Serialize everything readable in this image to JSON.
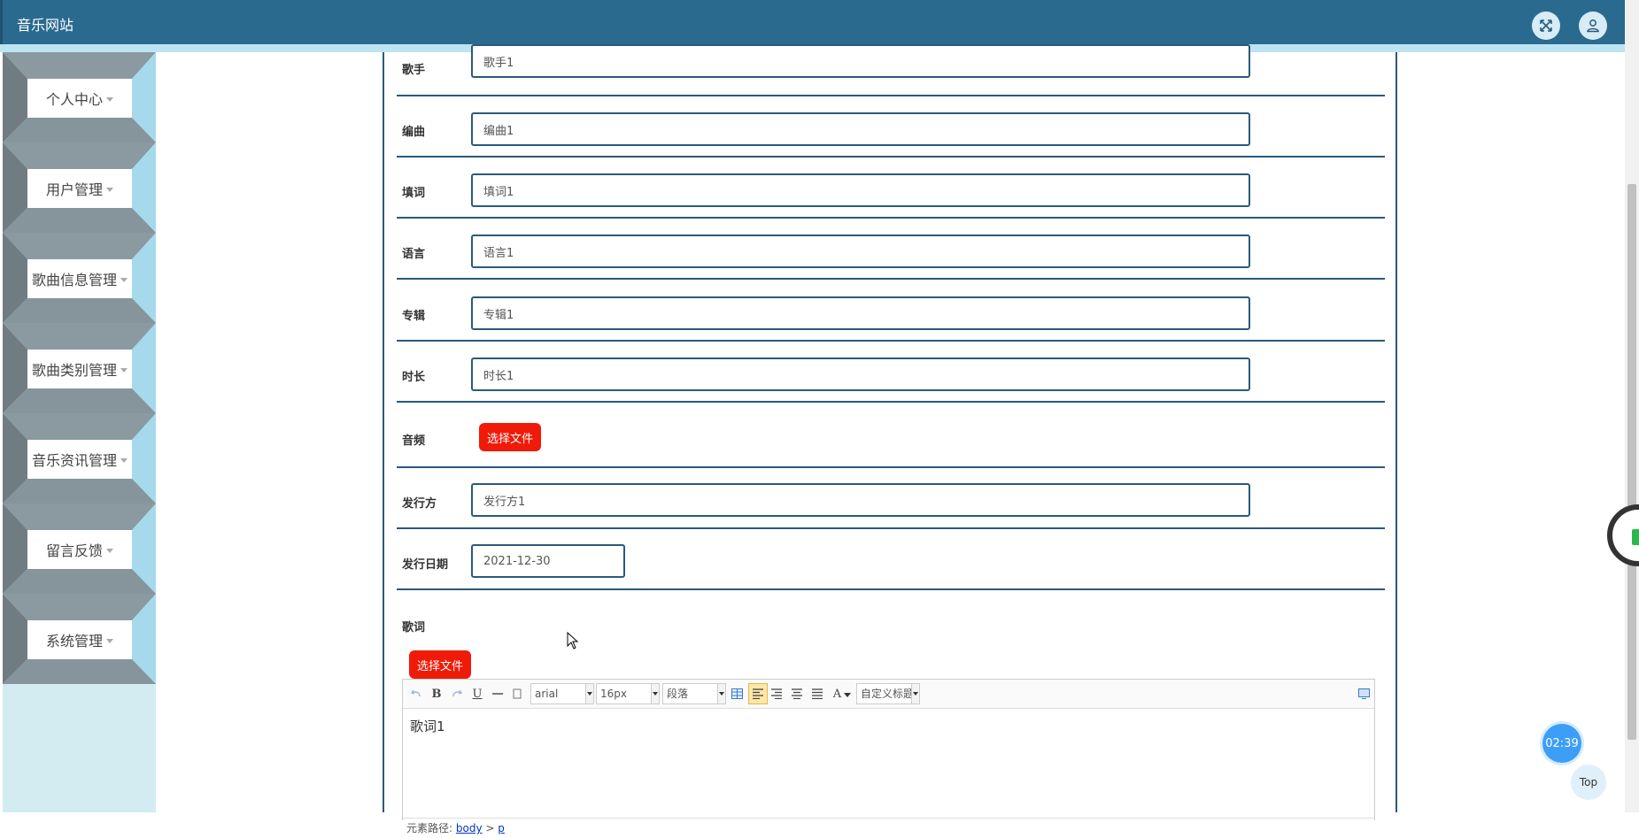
{
  "header": {
    "title": "音乐网站",
    "fullscreen_icon": "expand-arrows-icon",
    "user_icon": "user-icon"
  },
  "sidebar": {
    "items": [
      {
        "label": "个人中心"
      },
      {
        "label": "用户管理"
      },
      {
        "label": "歌曲信息管理"
      },
      {
        "label": "歌曲类别管理"
      },
      {
        "label": "音乐资讯管理"
      },
      {
        "label": "留言反馈"
      },
      {
        "label": "系统管理"
      }
    ]
  },
  "form": {
    "singer": {
      "label": "歌手",
      "value": "歌手1"
    },
    "composer": {
      "label": "编曲",
      "value": "编曲1"
    },
    "lyricist": {
      "label": "填词",
      "value": "填词1"
    },
    "language": {
      "label": "语言",
      "value": "语言1"
    },
    "album": {
      "label": "专辑",
      "value": "专辑1"
    },
    "duration": {
      "label": "时长",
      "value": "时长1"
    },
    "audio": {
      "label": "音频",
      "button": "选择文件"
    },
    "publisher": {
      "label": "发行方",
      "value": "发行方1"
    },
    "release_date": {
      "label": "发行日期",
      "value": "2021-12-30"
    },
    "lyrics": {
      "label": "歌词",
      "button": "选择文件"
    }
  },
  "editor": {
    "font_family": "arial",
    "font_size": "16px",
    "paragraph": "段落",
    "custom_title": "自定义标题",
    "content": "歌词1",
    "path_label": "元素路径:",
    "path_body": "body",
    "path_sep": ">",
    "path_p": "p",
    "tools": {
      "bold": "B",
      "underline": "U",
      "font_color": "A"
    }
  },
  "widgets": {
    "timer": "02:39",
    "top": "Top"
  },
  "colors": {
    "header": "#2a6a8e",
    "accent_red": "#f01a08",
    "border": "#2a5a7a",
    "sidebar_light": "#bde4f3",
    "timer_blue": "#3d9ef7"
  }
}
